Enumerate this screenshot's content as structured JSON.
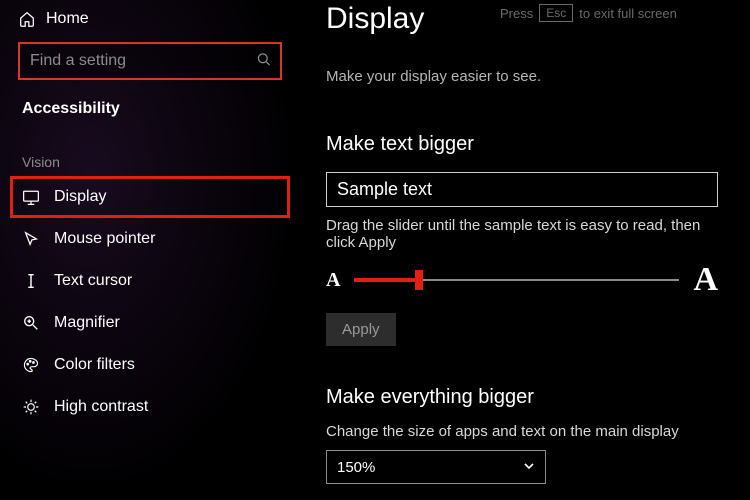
{
  "fullscreen_hint": {
    "pre": "Press",
    "key": "Esc",
    "post": "to exit full screen"
  },
  "sidebar": {
    "home_label": "Home",
    "search_placeholder": "Find a setting",
    "category_label": "Accessibility",
    "group": "Vision",
    "items": [
      {
        "label": "Display"
      },
      {
        "label": "Mouse pointer"
      },
      {
        "label": "Text cursor"
      },
      {
        "label": "Magnifier"
      },
      {
        "label": "Color filters"
      },
      {
        "label": "High contrast"
      }
    ]
  },
  "main": {
    "title": "Display",
    "subtitle": "Make your display easier to see.",
    "text_bigger": {
      "heading": "Make text bigger",
      "sample": "Sample text",
      "slider_desc": "Drag the slider until the sample text is easy to read, then click Apply",
      "small_a": "A",
      "big_a": "A",
      "slider_pct": 20,
      "apply_label": "Apply"
    },
    "everything_bigger": {
      "heading": "Make everything bigger",
      "desc": "Change the size of apps and text on the main display",
      "selected": "150%"
    }
  }
}
